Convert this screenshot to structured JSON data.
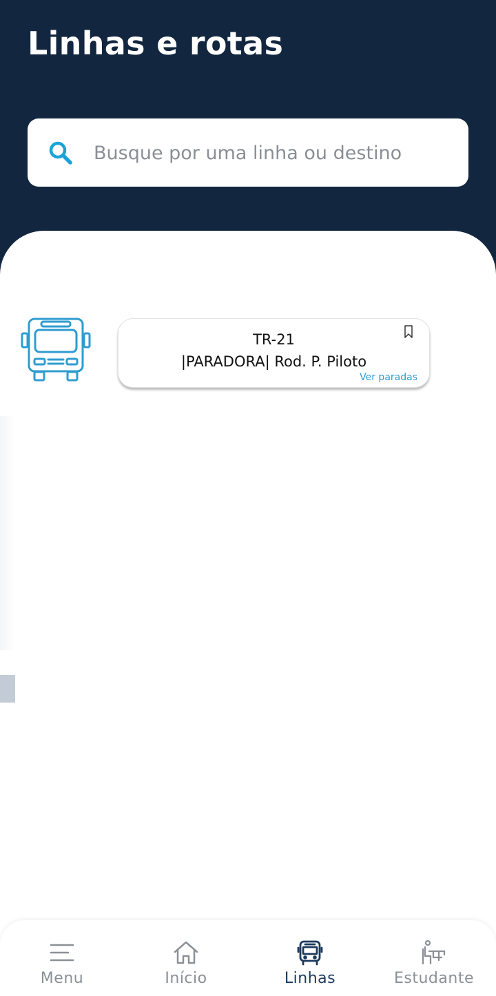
{
  "header": {
    "title": "Linhas e rotas"
  },
  "search": {
    "placeholder": "Busque por uma linha ou destino",
    "value": ""
  },
  "routes": [
    {
      "code": "TR-21",
      "name": "|PARADORA| Rod. P. Piloto",
      "link_label": "Ver paradas"
    }
  ],
  "icons": {
    "search": "search-icon",
    "bus": "bus-icon",
    "bookmark": "bookmark-icon"
  },
  "bottom_nav": {
    "items": [
      {
        "label": "Menu",
        "icon": "menu-icon",
        "active": false
      },
      {
        "label": "Início",
        "icon": "home-icon",
        "active": false
      },
      {
        "label": "Linhas",
        "icon": "bus-icon",
        "active": true
      },
      {
        "label": "Estudante",
        "icon": "student-icon",
        "active": false
      }
    ]
  },
  "colors": {
    "header_bg": "#12263f",
    "accent": "#2d9bd2",
    "active_nav": "#1c3a5e",
    "inactive_nav": "#8b9096"
  }
}
